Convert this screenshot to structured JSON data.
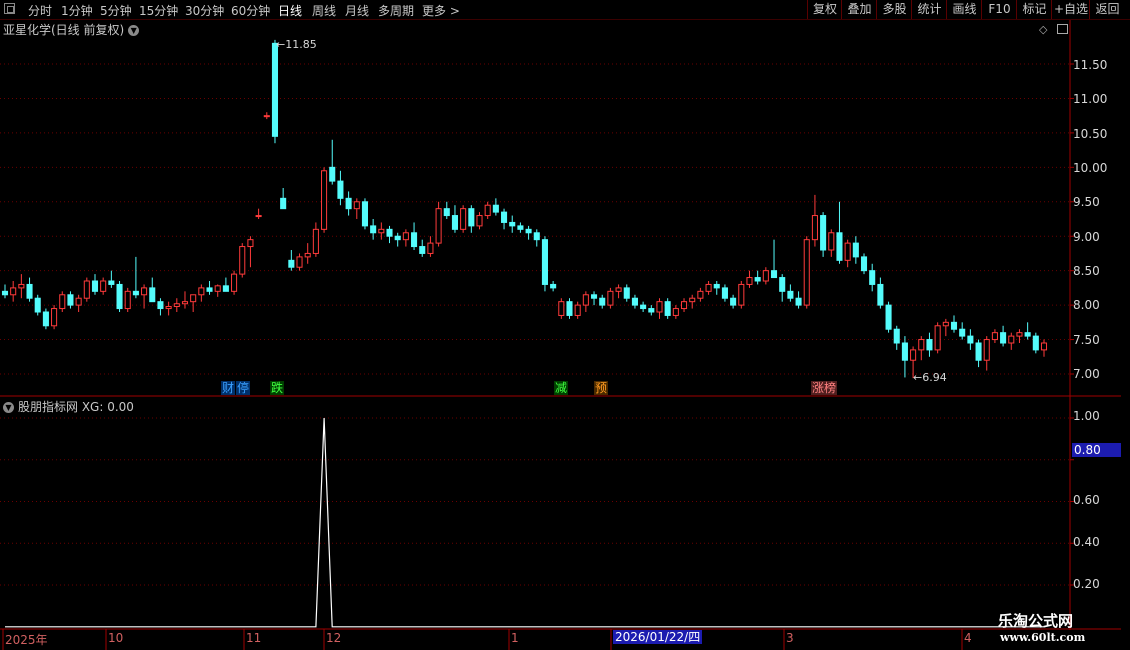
{
  "toolbar": {
    "periods": [
      "分时",
      "1分钟",
      "5分钟",
      "15分钟",
      "30分钟",
      "60分钟",
      "日线",
      "周线",
      "月线",
      "多周期",
      "更多 >"
    ],
    "active_period": "日线",
    "right_buttons": [
      "复权",
      "叠加",
      "多股",
      "统计",
      "画线",
      "F10",
      "标记",
      "+自选",
      "返回"
    ]
  },
  "chart_title": "亚星化学(日线 前复权)",
  "indicator_title": "股朋指标网 XG: 0.00",
  "price_axis": [
    "11.50",
    "11.00",
    "10.50",
    "10.00",
    "9.50",
    "9.00",
    "8.50",
    "8.00",
    "7.50",
    "7.00"
  ],
  "indicator_axis": [
    "1.00",
    "0.80",
    "0.60",
    "0.40",
    "0.20"
  ],
  "indicator_selected_value": "0.80",
  "high_annotation": "11.85",
  "low_annotation": "6.94",
  "event_tags": [
    {
      "text": "财",
      "color": "#3aa0ff",
      "bg": "#00306a"
    },
    {
      "text": "停",
      "color": "#3aa0ff",
      "bg": "#00306a"
    },
    {
      "text": "跌",
      "color": "#40ff40",
      "bg": "#004000"
    },
    {
      "text": "减",
      "color": "#40ff40",
      "bg": "#004000"
    },
    {
      "text": "预",
      "color": "#ff9a20",
      "bg": "#4a2a00"
    },
    {
      "text": "涨榜",
      "color": "#ff8080",
      "bg": "#502020"
    }
  ],
  "date_labels": [
    "2025年",
    "10",
    "11",
    "12",
    "1",
    "3",
    "4"
  ],
  "date_selected": "2026/01/22/四",
  "watermark_line1": "乐淘公式网",
  "watermark_line2": "www.60lt.com",
  "colors": {
    "up": "#ff3b3b",
    "down": "#54fcfc",
    "grid": "#6a0000",
    "axis_line": "#a00000",
    "indicator_line": "#ffffff"
  },
  "chart_data": {
    "type": "candlestick",
    "y_range": [
      6.8,
      11.95
    ],
    "indicator_range": [
      0,
      1.0
    ],
    "high_value": 11.85,
    "low_value": 6.94,
    "candles": [
      [
        8.2,
        8.3,
        8.1,
        8.15
      ],
      [
        8.15,
        8.35,
        8.05,
        8.25
      ],
      [
        8.25,
        8.45,
        8.1,
        8.3
      ],
      [
        8.3,
        8.4,
        8.05,
        8.1
      ],
      [
        8.1,
        8.15,
        7.85,
        7.9
      ],
      [
        7.9,
        7.95,
        7.65,
        7.7
      ],
      [
        7.7,
        8.0,
        7.65,
        7.95
      ],
      [
        7.95,
        8.2,
        7.9,
        8.15
      ],
      [
        8.15,
        8.2,
        7.95,
        8.0
      ],
      [
        8.0,
        8.15,
        7.9,
        8.1
      ],
      [
        8.1,
        8.4,
        8.05,
        8.35
      ],
      [
        8.35,
        8.45,
        8.15,
        8.2
      ],
      [
        8.2,
        8.4,
        8.15,
        8.35
      ],
      [
        8.35,
        8.5,
        8.25,
        8.3
      ],
      [
        8.3,
        8.35,
        7.9,
        7.95
      ],
      [
        7.95,
        8.25,
        7.9,
        8.2
      ],
      [
        8.2,
        8.7,
        8.1,
        8.15
      ],
      [
        8.15,
        8.3,
        7.95,
        8.25
      ],
      [
        8.25,
        8.4,
        8.1,
        8.05
      ],
      [
        8.05,
        8.1,
        7.85,
        7.95
      ],
      [
        7.95,
        8.05,
        7.85,
        7.98
      ],
      [
        7.98,
        8.1,
        7.9,
        8.02
      ],
      [
        8.02,
        8.2,
        7.95,
        8.05
      ],
      [
        8.05,
        8.15,
        7.9,
        8.15
      ],
      [
        8.15,
        8.3,
        8.05,
        8.25
      ],
      [
        8.25,
        8.35,
        8.15,
        8.2
      ],
      [
        8.2,
        8.3,
        8.12,
        8.28
      ],
      [
        8.28,
        8.4,
        8.2,
        8.2
      ],
      [
        8.2,
        8.5,
        8.15,
        8.45
      ],
      [
        8.45,
        8.9,
        8.4,
        8.85
      ],
      [
        8.85,
        9.0,
        8.55,
        8.95
      ],
      [
        9.3,
        9.4,
        9.25,
        9.3
      ],
      [
        10.75,
        10.8,
        10.7,
        10.75
      ],
      [
        11.8,
        11.85,
        10.35,
        10.45
      ],
      [
        9.55,
        9.7,
        9.4,
        9.4
      ],
      [
        8.65,
        8.8,
        8.5,
        8.55
      ],
      [
        8.55,
        8.75,
        8.5,
        8.7
      ],
      [
        8.7,
        8.9,
        8.6,
        8.75
      ],
      [
        8.75,
        9.2,
        8.7,
        9.1
      ],
      [
        9.1,
        10.0,
        9.05,
        9.95
      ],
      [
        10.0,
        10.4,
        9.75,
        9.8
      ],
      [
        9.8,
        9.95,
        9.45,
        9.55
      ],
      [
        9.55,
        9.65,
        9.3,
        9.4
      ],
      [
        9.4,
        9.55,
        9.25,
        9.5
      ],
      [
        9.5,
        9.55,
        9.1,
        9.15
      ],
      [
        9.15,
        9.25,
        8.95,
        9.05
      ],
      [
        9.05,
        9.2,
        8.95,
        9.1
      ],
      [
        9.1,
        9.15,
        8.9,
        9.0
      ],
      [
        9.0,
        9.05,
        8.85,
        8.95
      ],
      [
        8.95,
        9.1,
        8.85,
        9.05
      ],
      [
        9.05,
        9.2,
        8.8,
        8.85
      ],
      [
        8.85,
        8.95,
        8.7,
        8.75
      ],
      [
        8.75,
        9.0,
        8.7,
        8.9
      ],
      [
        8.9,
        9.5,
        8.85,
        9.4
      ],
      [
        9.4,
        9.5,
        9.25,
        9.3
      ],
      [
        9.3,
        9.45,
        9.05,
        9.1
      ],
      [
        9.1,
        9.45,
        9.05,
        9.4
      ],
      [
        9.4,
        9.45,
        9.05,
        9.15
      ],
      [
        9.15,
        9.35,
        9.1,
        9.3
      ],
      [
        9.3,
        9.5,
        9.25,
        9.45
      ],
      [
        9.45,
        9.55,
        9.3,
        9.35
      ],
      [
        9.35,
        9.4,
        9.1,
        9.2
      ],
      [
        9.2,
        9.3,
        9.05,
        9.15
      ],
      [
        9.15,
        9.2,
        9.05,
        9.1
      ],
      [
        9.1,
        9.15,
        8.95,
        9.05
      ],
      [
        9.05,
        9.1,
        8.85,
        8.95
      ],
      [
        8.95,
        9.0,
        8.2,
        8.3
      ],
      [
        8.3,
        8.35,
        8.2,
        8.25
      ],
      [
        7.85,
        8.1,
        7.8,
        8.05
      ],
      [
        8.05,
        8.1,
        7.8,
        7.85
      ],
      [
        7.85,
        8.05,
        7.8,
        8.0
      ],
      [
        8.0,
        8.2,
        7.9,
        8.15
      ],
      [
        8.15,
        8.2,
        8.0,
        8.1
      ],
      [
        8.1,
        8.15,
        7.95,
        8.0
      ],
      [
        8.0,
        8.25,
        7.95,
        8.2
      ],
      [
        8.2,
        8.3,
        8.1,
        8.25
      ],
      [
        8.25,
        8.3,
        8.05,
        8.1
      ],
      [
        8.1,
        8.15,
        7.95,
        8.0
      ],
      [
        8.0,
        8.05,
        7.9,
        7.95
      ],
      [
        7.95,
        8.0,
        7.85,
        7.9
      ],
      [
        7.9,
        8.1,
        7.8,
        8.05
      ],
      [
        8.05,
        8.1,
        7.8,
        7.85
      ],
      [
        7.85,
        8.0,
        7.8,
        7.95
      ],
      [
        7.95,
        8.1,
        7.9,
        8.05
      ],
      [
        8.05,
        8.15,
        7.95,
        8.1
      ],
      [
        8.1,
        8.25,
        8.05,
        8.2
      ],
      [
        8.2,
        8.35,
        8.15,
        8.3
      ],
      [
        8.3,
        8.35,
        8.15,
        8.25
      ],
      [
        8.25,
        8.3,
        8.05,
        8.1
      ],
      [
        8.1,
        8.15,
        7.95,
        8.0
      ],
      [
        8.0,
        8.35,
        7.95,
        8.3
      ],
      [
        8.3,
        8.5,
        8.25,
        8.4
      ],
      [
        8.4,
        8.5,
        8.3,
        8.35
      ],
      [
        8.35,
        8.55,
        8.3,
        8.5
      ],
      [
        8.5,
        8.95,
        8.4,
        8.4
      ],
      [
        8.4,
        8.45,
        8.05,
        8.2
      ],
      [
        8.2,
        8.3,
        8.05,
        8.1
      ],
      [
        8.1,
        8.2,
        7.95,
        8.0
      ],
      [
        8.0,
        9.0,
        7.95,
        8.95
      ],
      [
        8.95,
        9.6,
        8.85,
        9.3
      ],
      [
        9.3,
        9.35,
        8.7,
        8.8
      ],
      [
        8.8,
        9.1,
        8.7,
        9.05
      ],
      [
        9.05,
        9.5,
        8.6,
        8.65
      ],
      [
        8.65,
        8.95,
        8.55,
        8.9
      ],
      [
        8.9,
        9.0,
        8.6,
        8.7
      ],
      [
        8.7,
        8.75,
        8.45,
        8.5
      ],
      [
        8.5,
        8.6,
        8.2,
        8.3
      ],
      [
        8.3,
        8.4,
        7.95,
        8.0
      ],
      [
        8.0,
        8.05,
        7.6,
        7.65
      ],
      [
        7.65,
        7.7,
        7.35,
        7.45
      ],
      [
        7.45,
        7.55,
        6.95,
        7.2
      ],
      [
        7.2,
        7.4,
        6.94,
        7.35
      ],
      [
        7.35,
        7.55,
        7.2,
        7.5
      ],
      [
        7.5,
        7.6,
        7.25,
        7.35
      ],
      [
        7.35,
        7.75,
        7.3,
        7.7
      ],
      [
        7.7,
        7.8,
        7.55,
        7.75
      ],
      [
        7.75,
        7.85,
        7.6,
        7.65
      ],
      [
        7.65,
        7.75,
        7.5,
        7.55
      ],
      [
        7.55,
        7.65,
        7.35,
        7.45
      ],
      [
        7.45,
        7.5,
        7.1,
        7.2
      ],
      [
        7.2,
        7.55,
        7.05,
        7.5
      ],
      [
        7.5,
        7.65,
        7.45,
        7.6
      ],
      [
        7.6,
        7.7,
        7.4,
        7.45
      ],
      [
        7.45,
        7.6,
        7.35,
        7.55
      ],
      [
        7.55,
        7.65,
        7.45,
        7.6
      ],
      [
        7.6,
        7.75,
        7.5,
        7.55
      ],
      [
        7.55,
        7.6,
        7.3,
        7.35
      ],
      [
        7.35,
        7.5,
        7.25,
        7.45
      ]
    ],
    "indicator_peak_index": 39,
    "indicator_peak_value": 1.0
  }
}
